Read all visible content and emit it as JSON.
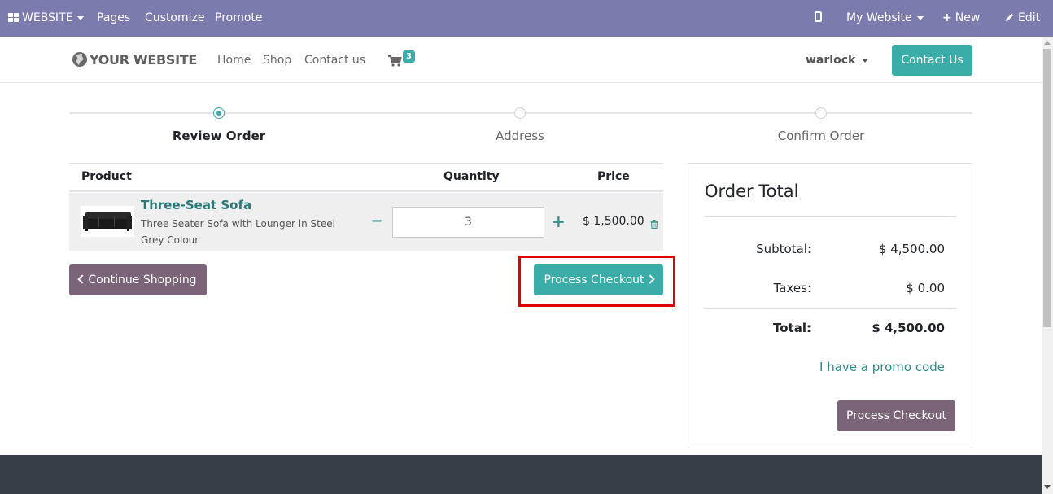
{
  "admin_bar": {
    "website_menu": "WEBSITE",
    "pages": "Pages",
    "customize": "Customize",
    "promote": "Promote",
    "site_switcher": "My Website",
    "new": "New",
    "edit": "Edit"
  },
  "header": {
    "logo_text": "YOUR WEBSITE",
    "nav": [
      "Home",
      "Shop",
      "Contact us"
    ],
    "cart_count": "3",
    "user_name": "warlock",
    "contact_button": "Contact Us"
  },
  "wizard": {
    "steps": [
      "Review Order",
      "Address",
      "Confirm Order"
    ],
    "active_step": 0
  },
  "cart": {
    "headers": {
      "product": "Product",
      "quantity": "Quantity",
      "price": "Price"
    },
    "line": {
      "name": "Three-Seat Sofa",
      "description": "Three Seater Sofa with Lounger in Steel Grey Colour",
      "quantity": "3",
      "price": "$ 1,500.00"
    },
    "continue_button": "Continue Shopping",
    "checkout_button": "Process Checkout"
  },
  "order_total": {
    "title": "Order Total",
    "subtotal_label": "Subtotal:",
    "subtotal_value": "$ 4,500.00",
    "taxes_label": "Taxes:",
    "taxes_value": "$ 0.00",
    "total_label": "Total:",
    "total_value": "$ 4,500.00",
    "promo_link": "I have a promo code",
    "checkout_button": "Process Checkout"
  },
  "colors": {
    "admin_bar": "#7c7bad",
    "primary": "#3aada8",
    "secondary": "#7b6478",
    "highlight": "#e00000",
    "footer": "#383e45"
  }
}
